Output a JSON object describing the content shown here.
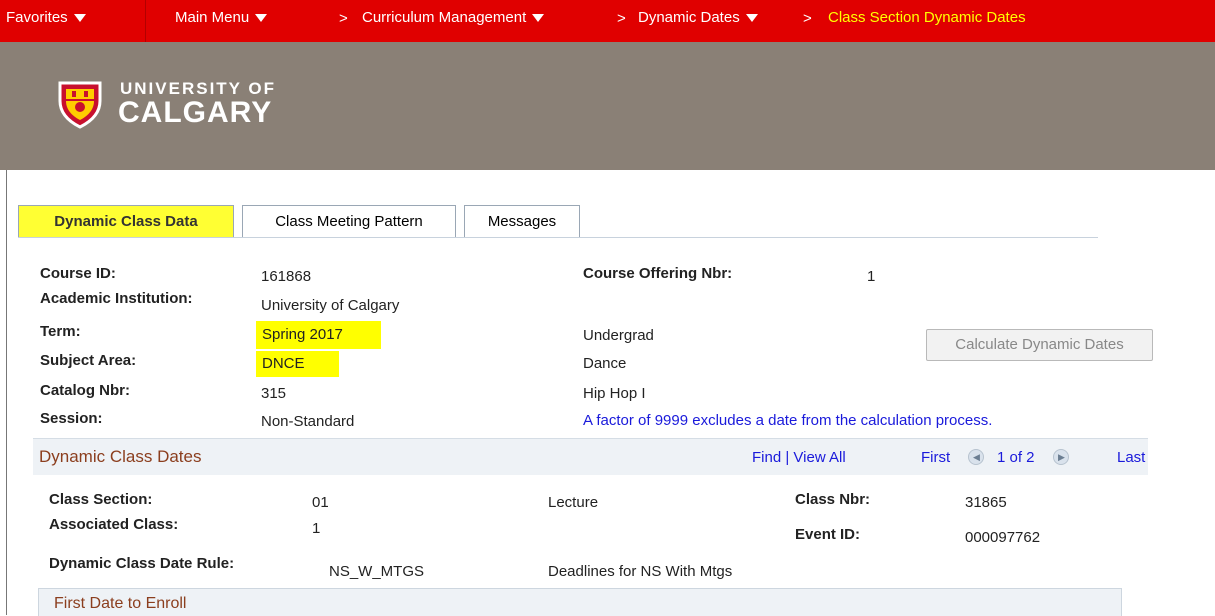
{
  "nav": {
    "favorites": "Favorites",
    "main_menu": "Main Menu",
    "curriculum": "Curriculum Management",
    "dynamic_dates": "Dynamic Dates",
    "current": "Class Section Dynamic Dates",
    "chevron": ">"
  },
  "brand": {
    "line1": "UNIVERSITY OF",
    "line2": "CALGARY"
  },
  "tabs": [
    {
      "label": "Dynamic Class Data"
    },
    {
      "label": "Class Meeting Pattern"
    },
    {
      "label": "Messages"
    }
  ],
  "course": {
    "course_id_label": "Course ID:",
    "course_id": "161868",
    "offering_label": "Course Offering Nbr:",
    "offering": "1",
    "institution_label": "Academic Institution:",
    "institution": "University of Calgary",
    "term_label": "Term:",
    "term": "Spring 2017",
    "career": "Undergrad",
    "subject_label": "Subject Area:",
    "subject": "DNCE",
    "subject_desc": "Dance",
    "catalog_label": "Catalog Nbr:",
    "catalog": "315",
    "catalog_desc": "Hip Hop I",
    "session_label": "Session:",
    "session": "Non-Standard",
    "note": "A factor of 9999 excludes a date from the calculation process."
  },
  "calculate_button": "Calculate Dynamic Dates",
  "dates_section": {
    "title": "Dynamic Class Dates",
    "find": "Find | View All",
    "first": "First",
    "count": "1 of 2",
    "last": "Last"
  },
  "class": {
    "section_label": "Class Section:",
    "section": "01",
    "component": "Lecture",
    "nbr_label": "Class Nbr:",
    "nbr": "31865",
    "assoc_label": "Associated Class:",
    "assoc": "1",
    "event_label": "Event ID:",
    "event": "000097762",
    "rule_label": "Dynamic Class Date Rule:",
    "rule": "NS_W_MTGS",
    "rule_desc": "Deadlines for NS With Mtgs"
  },
  "first_date_section": "First Date to Enroll",
  "colors": {
    "nav_bg": "#e00000",
    "banner_bg": "#8a8076",
    "highlight": "#ffff00",
    "link": "#1a1adb",
    "section_title": "#8b3e1e"
  }
}
